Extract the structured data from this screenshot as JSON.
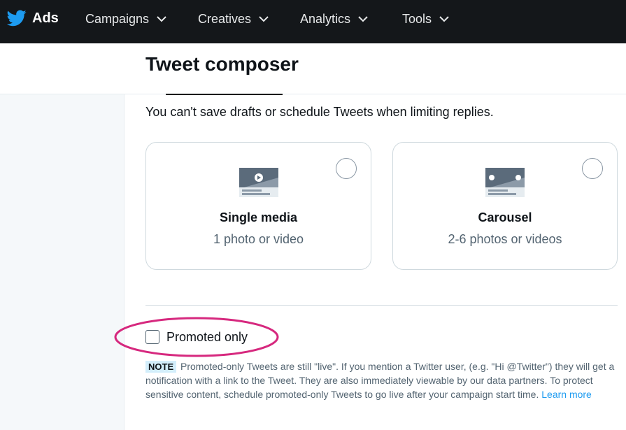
{
  "nav": {
    "brand_label": "Ads",
    "items": [
      {
        "label": "Campaigns"
      },
      {
        "label": "Creatives"
      },
      {
        "label": "Analytics"
      },
      {
        "label": "Tools"
      }
    ],
    "icons": {
      "logo": "twitter-bird-icon",
      "dropdown": "chevron-down-icon"
    },
    "colors": {
      "bar": "#14171a",
      "logo": "#1d9bf0"
    }
  },
  "header": {
    "title": "Tweet composer"
  },
  "composer": {
    "info_text": "You can't save drafts or schedule Tweets when limiting replies.",
    "formats": [
      {
        "title": "Single media",
        "subtitle": "1 photo or video",
        "selected": false,
        "icon": "single-media-icon"
      },
      {
        "title": "Carousel",
        "subtitle": "2-6 photos or videos",
        "selected": false,
        "icon": "carousel-icon"
      }
    ],
    "promoted_only": {
      "label": "Promoted only",
      "checked": false
    },
    "note": {
      "badge": "NOTE",
      "text": "Promoted-only Tweets are still \"live\". If you mention a Twitter user, (e.g. \"Hi @Twitter\") they will get a notification with a link to the Tweet. They are also immediately viewable by our data partners. To protect sensitive content, schedule promoted-only Tweets to go live after your campaign start time.",
      "link": "Learn more"
    }
  },
  "annotation": {
    "color": "#d6287e"
  }
}
